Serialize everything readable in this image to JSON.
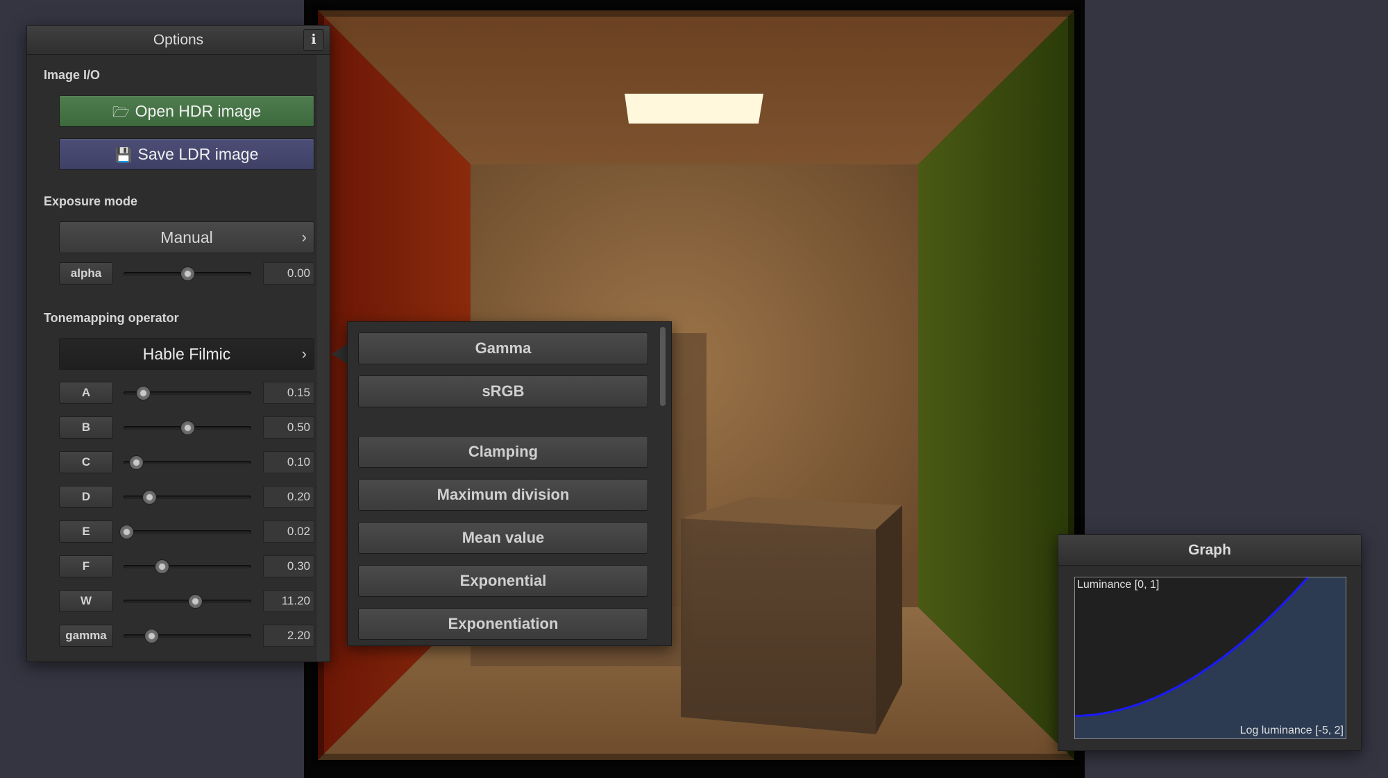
{
  "options": {
    "title": "Options",
    "info": "i",
    "image_io": {
      "label": "Image I/O",
      "open_button": "Open HDR image",
      "open_icon": "folder-open-icon",
      "save_button": "Save LDR image",
      "save_icon": "floppy-disk-icon"
    },
    "exposure": {
      "label": "Exposure mode",
      "mode": "Manual",
      "alpha": {
        "label": "alpha",
        "value": "0.00",
        "fraction": 0.5
      }
    },
    "tonemapping": {
      "label": "Tonemapping operator",
      "operator": "Hable Filmic",
      "params": [
        {
          "label": "A",
          "value": "0.15",
          "fraction": 0.15
        },
        {
          "label": "B",
          "value": "0.50",
          "fraction": 0.5
        },
        {
          "label": "C",
          "value": "0.10",
          "fraction": 0.1
        },
        {
          "label": "D",
          "value": "0.20",
          "fraction": 0.2
        },
        {
          "label": "E",
          "value": "0.02",
          "fraction": 0.02
        },
        {
          "label": "F",
          "value": "0.30",
          "fraction": 0.3
        },
        {
          "label": "W",
          "value": "11.20",
          "fraction": 0.56
        },
        {
          "label": "gamma",
          "value": "2.20",
          "fraction": 0.22
        }
      ]
    }
  },
  "popup": {
    "items": [
      "Gamma",
      "sRGB",
      "Clamping",
      "Maximum division",
      "Mean value",
      "Exponential",
      "Exponentiation"
    ]
  },
  "graph": {
    "title": "Graph",
    "y_label": "Luminance [0, 1]",
    "x_label": "Log luminance [-5, 2]",
    "curve_color": "#1a1aff",
    "fill_color": "#2c3a52"
  }
}
